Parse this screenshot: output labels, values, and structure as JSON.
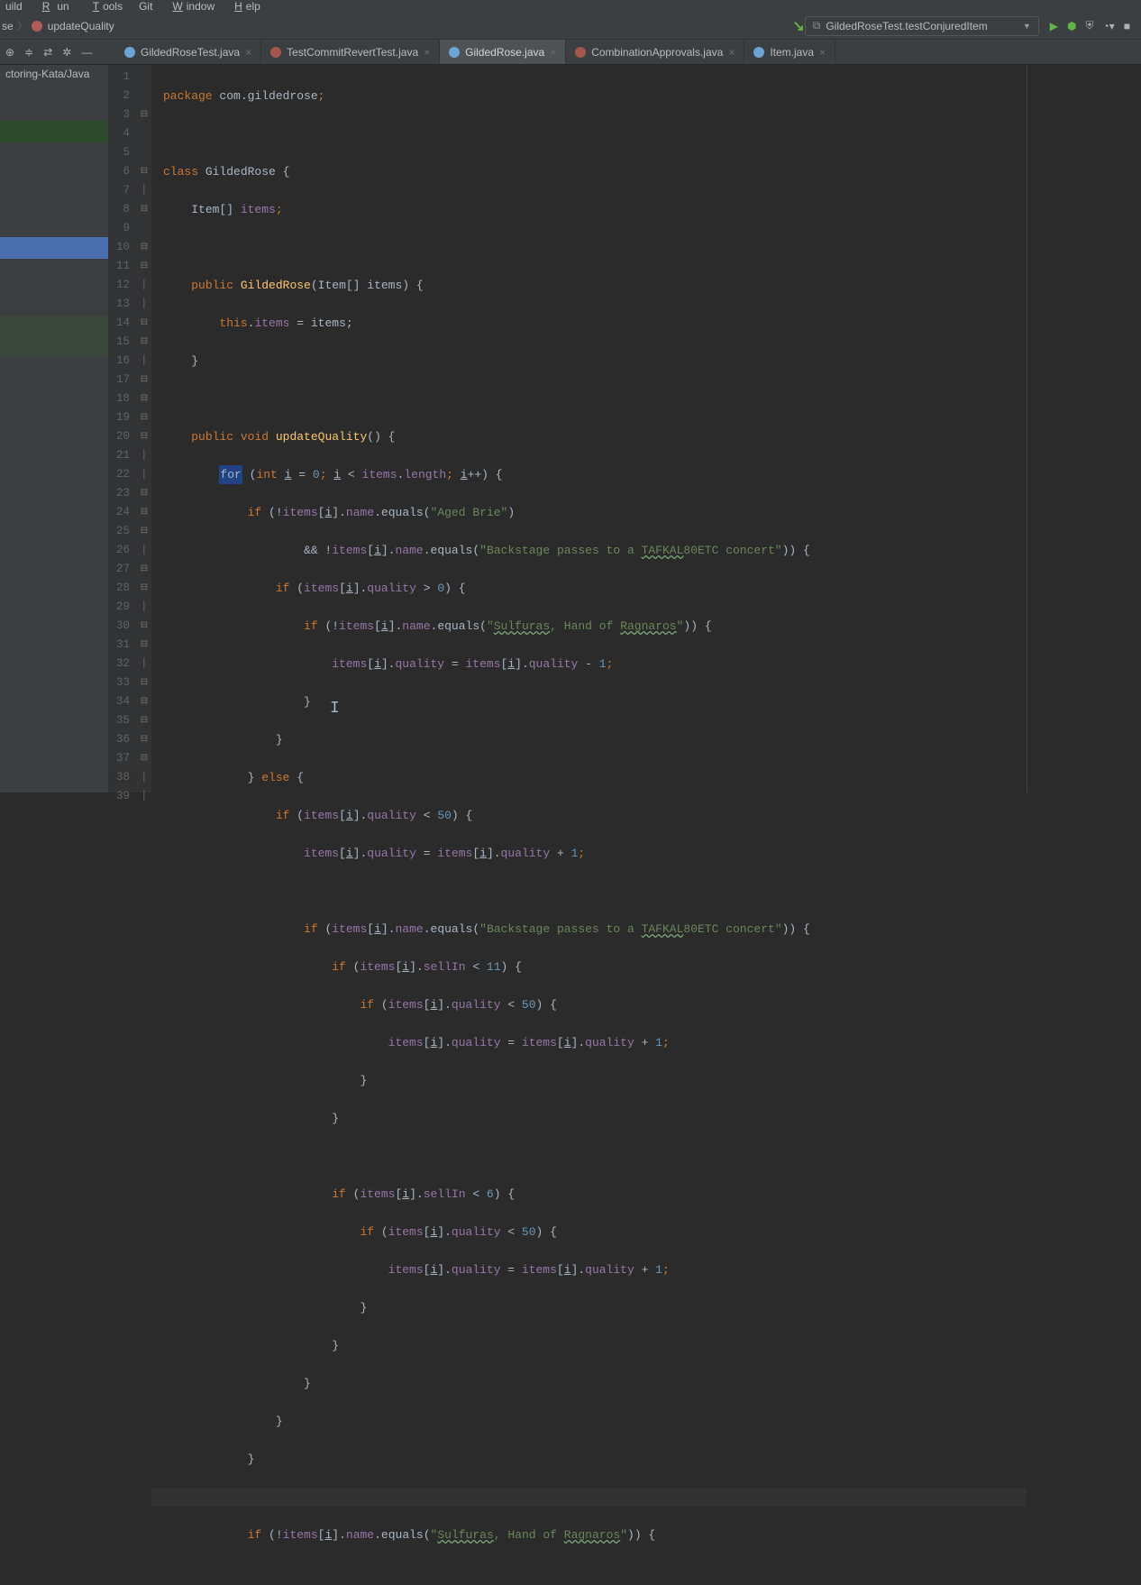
{
  "menubar": {
    "build": "uild",
    "run": "Run",
    "tools": "Tools",
    "git": "Git",
    "window": "Window",
    "help": "Help"
  },
  "breadcrumbs": {
    "item1": "se",
    "item2": "updateQuality"
  },
  "run_config": {
    "label": "GildedRoseTest.testConjuredItem"
  },
  "tabs": [
    {
      "label": "GildedRoseTest.java",
      "icon": "test",
      "active": false
    },
    {
      "label": "TestCommitRevertTest.java",
      "icon": "test",
      "active": false
    },
    {
      "label": "GildedRose.java",
      "icon": "java",
      "active": true
    },
    {
      "label": "CombinationApprovals.java",
      "icon": "test",
      "active": false
    },
    {
      "label": "Item.java",
      "icon": "java",
      "active": false
    }
  ],
  "project_tree": {
    "path_fragment": "ctoring-Kata/Java"
  },
  "line_numbers": [
    "1",
    "2",
    "3",
    "4",
    "5",
    "6",
    "7",
    "8",
    "9",
    "10",
    "11",
    "12",
    "13",
    "14",
    "15",
    "16",
    "17",
    "18",
    "19",
    "20",
    "21",
    "22",
    "23",
    "24",
    "25",
    "26",
    "27",
    "28",
    "29",
    "30",
    "31",
    "32",
    "33",
    "34",
    "35",
    "36",
    "37",
    "38",
    "39"
  ],
  "code": {
    "l1": {
      "pre": "package",
      "pkg": " com.gildedrose",
      "t": ";"
    },
    "l3": {
      "kw": "class",
      "name": " GildedRose ",
      "b": "{"
    },
    "l4": {
      "pad": "    ",
      "type": "Item[] ",
      "field": "items",
      "t": ";"
    },
    "l6": {
      "pad": "    ",
      "kw": "public",
      "name": " GildedRose",
      "sig": "(Item[] items) {"
    },
    "l7": {
      "pad": "        ",
      "kw": "this",
      "dot": ".",
      "field": "items",
      "rest": " = items;"
    },
    "l8": {
      "pad": "    ",
      "b": "}"
    },
    "l10": {
      "pad": "    ",
      "kw": "public void",
      "name": " updateQuality",
      "sig": "() {"
    },
    "l11a": "        ",
    "l11for": "for",
    "l11b": " (",
    "l11int": "int",
    "l11c": " ",
    "l11d": " = ",
    "l11z": "0",
    "l11e": "; ",
    "l11f": " < ",
    "l11g": "items",
    "l11h": ".",
    "l11len": "length",
    "l11i": "; ",
    "l11j": "++) {",
    "l12": {
      "pad": "            ",
      "kw": "if",
      "b": " (!",
      "f": "items",
      "c": "[",
      "d": "].",
      "n": "name",
      "e": ".equals(",
      "s": "\"Aged Brie\"",
      "t": ")"
    },
    "l13": {
      "pad": "                    ",
      "a": "&& !",
      "f": "items",
      "c": "[",
      "d": "].",
      "n": "name",
      "e": ".equals(",
      "s1": "\"Backstage passes to a ",
      "su": "TAFKAL",
      "s2": "80ETC concert\"",
      "t": ")) {"
    },
    "l14": {
      "pad": "                ",
      "kw": "if",
      "b": " (",
      "f": "items",
      "c": "[",
      "d": "].",
      "fld": "quality",
      "op": " > ",
      "n": "0",
      "t": ") {"
    },
    "l15": {
      "pad": "                    ",
      "kw": "if",
      "b": " (!",
      "f": "items",
      "c": "[",
      "d": "].",
      "n": "name",
      "e": ".equals(",
      "s1": "\"",
      "su1": "Sulfuras",
      "s2": ", Hand of ",
      "su2": "Ragnaros",
      "s3": "\"",
      "t": ")) {"
    },
    "l16": {
      "pad": "                        ",
      "f": "items",
      "c": "[",
      "d": "].",
      "fld": "quality",
      "eq": " = ",
      "f2": "items",
      "c2": "[",
      "d2": "].",
      "fld2": "quality",
      "op": " - ",
      "n": "1",
      "t": ";"
    },
    "l17": {
      "pad": "                    ",
      "b": "}"
    },
    "l18": {
      "pad": "                ",
      "b": "}"
    },
    "l19": {
      "pad": "            ",
      "b": "} ",
      "kw": "else",
      "c": " {"
    },
    "l20": {
      "pad": "                ",
      "kw": "if",
      "b": " (",
      "f": "items",
      "c": "[",
      "d": "].",
      "fld": "quality",
      "op": " < ",
      "n": "50",
      "t": ") {"
    },
    "l21": {
      "pad": "                    ",
      "f": "items",
      "c": "[",
      "d": "].",
      "fld": "quality",
      "eq": " = ",
      "f2": "items",
      "c2": "[",
      "d2": "].",
      "fld2": "quality",
      "op": " + ",
      "n": "1",
      "t": ";"
    },
    "l23": {
      "pad": "                    ",
      "kw": "if",
      "b": " (",
      "f": "items",
      "c": "[",
      "d": "].",
      "n": "name",
      "e": ".equals(",
      "s1": "\"Backstage passes to a ",
      "su": "TAFKAL",
      "s2": "80ETC concert\"",
      "t": ")) {"
    },
    "l24": {
      "pad": "                        ",
      "kw": "if",
      "b": " (",
      "f": "items",
      "c": "[",
      "d": "].",
      "fld": "sellIn",
      "op": " < ",
      "n": "11",
      "t": ") {"
    },
    "l25": {
      "pad": "                            ",
      "kw": "if",
      "b": " (",
      "f": "items",
      "c": "[",
      "d": "].",
      "fld": "quality",
      "op": " < ",
      "n": "50",
      "t": ") {"
    },
    "l26": {
      "pad": "                                ",
      "f": "items",
      "c": "[",
      "d": "].",
      "fld": "quality",
      "eq": " = ",
      "f2": "items",
      "c2": "[",
      "d2": "].",
      "fld2": "quality",
      "op": " + ",
      "n": "1",
      "t": ";"
    },
    "l27": {
      "pad": "                            ",
      "b": "}"
    },
    "l28": {
      "pad": "                        ",
      "b": "}"
    },
    "l30": {
      "pad": "                        ",
      "kw": "if",
      "b": " (",
      "f": "items",
      "c": "[",
      "d": "].",
      "fld": "sellIn",
      "op": " < ",
      "n": "6",
      "t": ") {"
    },
    "l31": {
      "pad": "                            ",
      "kw": "if",
      "b": " (",
      "f": "items",
      "c": "[",
      "d": "].",
      "fld": "quality",
      "op": " < ",
      "n": "50",
      "t": ") {"
    },
    "l32": {
      "pad": "                                ",
      "f": "items",
      "c": "[",
      "d": "].",
      "fld": "quality",
      "eq": " = ",
      "f2": "items",
      "c2": "[",
      "d2": "].",
      "fld2": "quality",
      "op": " + ",
      "n": "1",
      "t": ";"
    },
    "l33": {
      "pad": "                            ",
      "b": "}"
    },
    "l34": {
      "pad": "                        ",
      "b": "}"
    },
    "l35": {
      "pad": "                    ",
      "b": "}"
    },
    "l36": {
      "pad": "                ",
      "b": "}"
    },
    "l37": {
      "pad": "            ",
      "b": "}"
    },
    "l39": {
      "pad": "            ",
      "kw": "if",
      "b": " (!",
      "f": "items",
      "c": "[",
      "d": "].",
      "n": "name",
      "e": ".equals(",
      "s1": "\"",
      "su1": "Sulfuras",
      "s2": ", Hand of ",
      "su2": "Ragnaros",
      "s3": "\"",
      "t": ")) {"
    }
  }
}
